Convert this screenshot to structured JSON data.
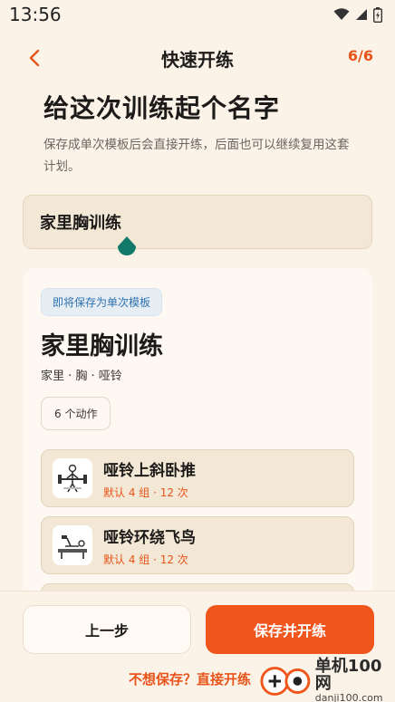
{
  "status_bar": {
    "time": "13:56",
    "icons": [
      "wifi-icon",
      "cellular-icon",
      "battery-icon"
    ]
  },
  "topbar": {
    "title": "快速开练",
    "step": "6/6",
    "back_icon": "chevron-left-icon"
  },
  "heading": "给这次训练起个名字",
  "subheading": "保存成单次模板后会直接开练，后面也可以继续复用这套计划。",
  "name_input": {
    "value": "家里胸训练"
  },
  "preview": {
    "badge": "即将保存为单次模板",
    "title": "家里胸训练",
    "tags": "家里 · 胸 · 哑铃",
    "count_chip": "6 个动作",
    "exercises": [
      {
        "name": "哑铃上斜卧推",
        "meta": "默认 4 组 · 12 次",
        "icon": "incline-press-illustration"
      },
      {
        "name": "哑铃环绕飞鸟",
        "meta": "默认 4 组 · 12 次",
        "icon": "dumbbell-fly-illustration"
      }
    ]
  },
  "bottom": {
    "prev_label": "上一步",
    "save_label": "保存并开练",
    "skip_label": "不想保存？直接开练"
  },
  "watermark": {
    "line1": "单机100网",
    "line2": "danji100.com"
  },
  "colors": {
    "accent": "#f0561c",
    "background": "#fbf3e8",
    "badge_blue": "#2f72b0",
    "cursor_teal": "#137a6b"
  }
}
